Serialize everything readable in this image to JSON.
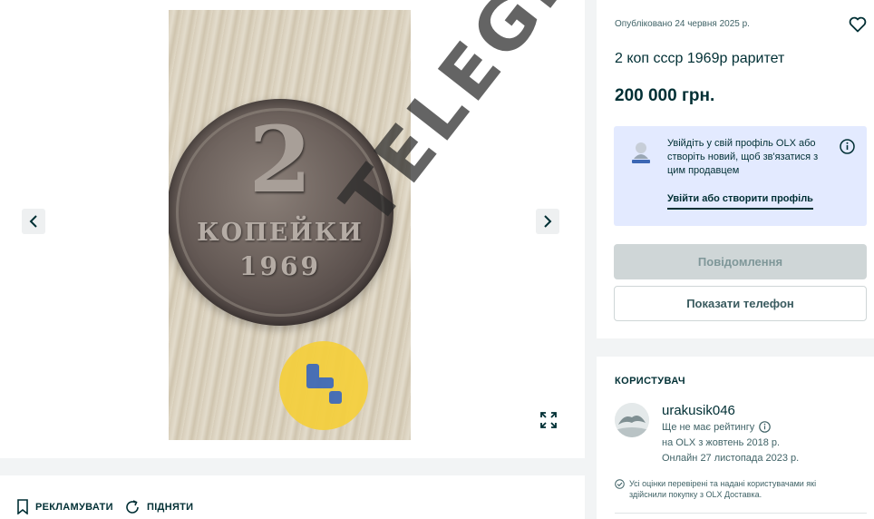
{
  "gallery": {
    "coin_denomination": "2",
    "coin_word": "КОПЕЙКИ",
    "coin_year": "1969",
    "watermark": "TELEGRAF",
    "prev_icon": "chevron-left-icon",
    "next_icon": "chevron-right-icon",
    "expand_icon": "fullscreen-icon"
  },
  "actions": {
    "promote_label": "РЕКЛАМУВАТИ",
    "promote_icon": "bookmark-icon",
    "raise_label": "ПІДНЯТИ",
    "raise_icon": "refresh-icon"
  },
  "ad": {
    "published": "Опубліковано 24 червня 2025 р.",
    "title": "2 коп ссср 1969р раритет",
    "price": "200 000 грн.",
    "favorite_icon": "heart-icon"
  },
  "login_prompt": {
    "text": "Увійдіть у свій профіль OLX або створіть новий, щоб зв'язатися з цим продавцем",
    "link": "Увійти або створити профіль",
    "info_icon": "info-icon"
  },
  "buttons": {
    "message": "Повідомлення",
    "phone": "Показати телефон"
  },
  "user": {
    "heading": "КОРИСТУВАЧ",
    "name": "urakusik046",
    "rating": "Ще не має рейтингу",
    "since": "на OLX з жовтень 2018 р.",
    "online": "Онлайн 27 листопада 2023 р.",
    "verified_note": "Усі оцінки перевірені та надані користувачами які здійснили покупку з OLX Доставка."
  },
  "colors": {
    "page_bg": "#f2f4f5",
    "text_primary": "#002f34",
    "info_box_bg": "#e3eaff",
    "disabled_button": "#cfd6d7",
    "logo_yellow": "#f5cf3b",
    "logo_blue": "#3c67b4"
  }
}
